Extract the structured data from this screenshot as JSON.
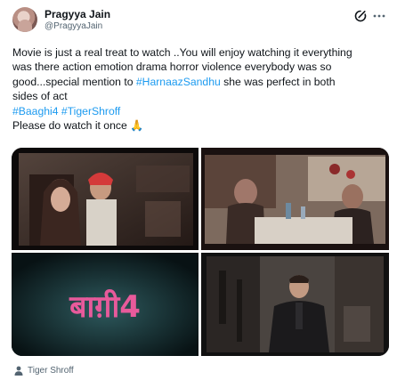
{
  "author": {
    "name": "Pragyya Jain",
    "handle": "@PragyyaJain",
    "avatar_icon": "profile-photo"
  },
  "actions": {
    "grok_icon": "grok-icon",
    "more_icon": "more-options-icon"
  },
  "tweet": {
    "line1": "Movie is just a real treat to watch ..You will enjoy watching it everything",
    "line2": "was there action emotion drama horror violence everybody was so",
    "line3_prefix": "good...special mention to ",
    "line3_mention": "#HarnaazSandhu",
    "line3_suffix": " she was perfect in both",
    "line4": "sides of act",
    "hashtag1": "#Baaghi4",
    "hashtag2": "#TigerShroff",
    "line6": "Please do watch it once 🙏"
  },
  "media": {
    "images": [
      {
        "description_icon": "movie-screen-photo-1"
      },
      {
        "description_icon": "movie-screen-photo-2"
      },
      {
        "title_text": "बाग़ी4"
      },
      {
        "description_icon": "movie-screen-photo-4"
      }
    ]
  },
  "tag": {
    "icon": "person-icon",
    "label": "Tiger Shroff"
  },
  "colors": {
    "link": "#1d9bf0",
    "text": "#0f1419",
    "secondary": "#536471",
    "title_pink": "#e85a9b"
  }
}
